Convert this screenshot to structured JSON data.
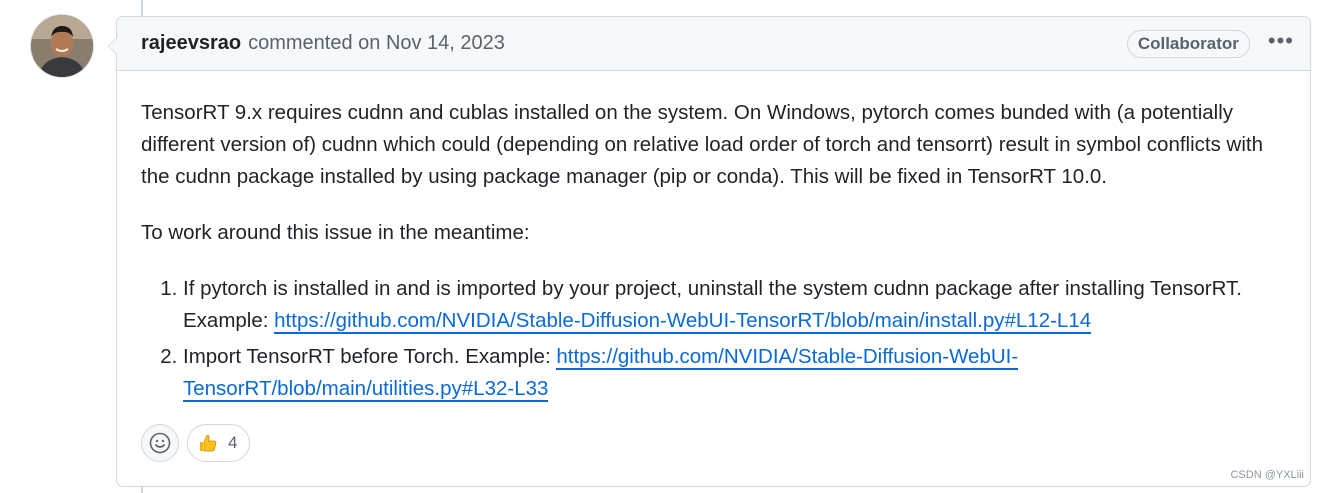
{
  "comment": {
    "author": "rajeevsrao",
    "action": "commented on",
    "date": "Nov 14, 2023",
    "role_badge": "Collaborator",
    "menu_icon": "kebab-horizontal-icon",
    "body": {
      "paragraph1": "TensorRT 9.x requires cudnn and cublas installed on the system. On Windows, pytorch comes bunded with (a potentially different version of) cudnn which could (depending on relative load order of torch and tensorrt) result in symbol conflicts with the cudnn package installed by using package manager (pip or conda). This will be fixed in TensorRT 10.0.",
      "paragraph2": "To work around this issue in the meantime:",
      "steps": [
        {
          "text": "If pytorch is installed in and is imported by your project, uninstall the system cudnn package after installing TensorRT. Example: ",
          "link": "https://github.com/NVIDIA/Stable-Diffusion-WebUI-TensorRT/blob/main/install.py#L12-L14"
        },
        {
          "text": "Import TensorRT before Torch. Example: ",
          "link": "https://github.com/NVIDIA/Stable-Diffusion-WebUI-TensorRT/blob/main/utilities.py#L32-L33"
        }
      ]
    },
    "reactions": {
      "add_icon": "smiley-icon",
      "items": [
        {
          "emoji_icon": "thumbs-up-icon",
          "count": "4"
        }
      ]
    }
  },
  "watermark": "CSDN @YXLiii",
  "colors": {
    "link": "#0969da",
    "border": "#d0d7de",
    "header_bg": "#f6f8fa",
    "muted_text": "#59636e"
  }
}
